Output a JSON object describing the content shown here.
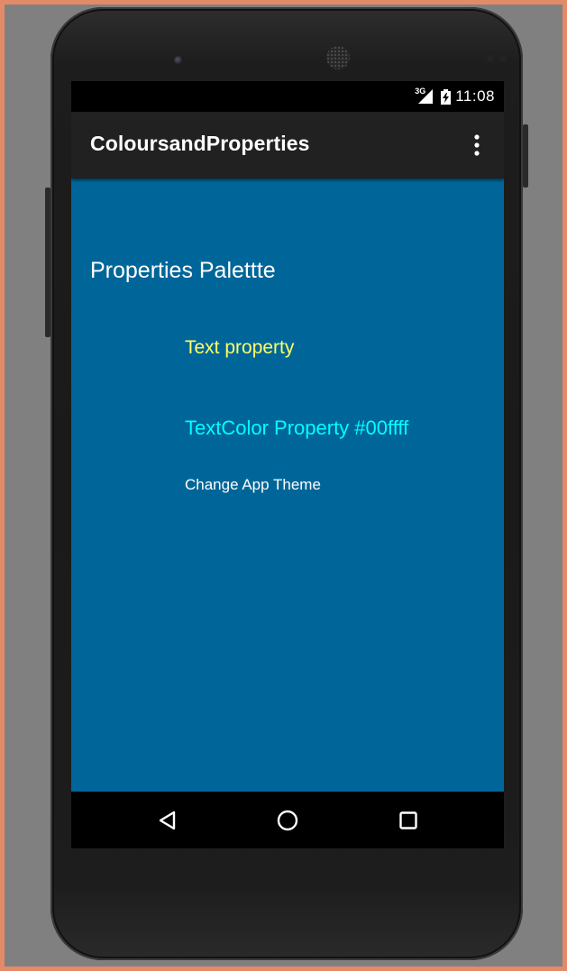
{
  "status_bar": {
    "network": "3G",
    "time": "11:08"
  },
  "action_bar": {
    "title": "ColoursandProperties",
    "overflow_icon": "more-vert-icon"
  },
  "content": {
    "background_color": "#006699",
    "heading": "Properties Palettte",
    "text_property": "Text property",
    "text_property_color": "#ffff66",
    "textcolor_property": "TextColor Property #00ffff",
    "textcolor_property_color": "#00ffff",
    "change_theme_button": "Change App Theme"
  },
  "nav_bar": {
    "back_icon": "back-triangle-icon",
    "home_icon": "home-circle-icon",
    "recents_icon": "recents-square-icon"
  }
}
